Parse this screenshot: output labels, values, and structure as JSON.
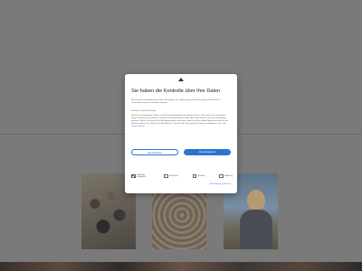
{
  "modal": {
    "title": "Sie haben die Kontrolle über Ihre Daten",
    "intro": "Wir und unsere Geschäftspartner nutzen Technologien wie Cookies dazu, personenbezogene Informationen für verschiedene Zwecke zu sammeln, darunter:",
    "purposes": "Funktional, Statistik, Marketing",
    "body_text": "Wenn Sie auf „Akzeptieren“ klicken, erteilen Sie Ihre Einwilligung für alle diese Zwecke. Sie können auch entscheiden, welchen Zwecken Sie zustimmen, indem Sie das Kontrollkästchen neben dem Zweck anklicken und auf „Einstellungen speichern“ klicken. Sie können Ihre Einwilligung jederzeit widerrufen, indem Sie auf das kleine Symbol unten links auf der Webseite klicken. Durch Klicken auf „Alle ablehnen“ fahren Sie fort, ohne optionale Cookies zu akzeptieren.",
    "more_link": "Mehr über Cookies erfahren",
    "reject_label": "Alle ablehnen",
    "accept_label": "Alle akzeptieren",
    "toggles": [
      {
        "label": "Unbedingt erforderlich",
        "checked": true
      },
      {
        "label": "Funktional",
        "checked": false
      },
      {
        "label": "Statistik",
        "checked": false
      },
      {
        "label": "Marketing",
        "checked": false
      }
    ],
    "settings_label": "Einstellungen speichern",
    "colors": {
      "accent": "#2f73d0",
      "overlay": "#7a7a7a"
    }
  }
}
